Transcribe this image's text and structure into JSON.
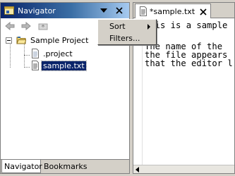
{
  "navigator": {
    "title": "Navigator",
    "tree": {
      "project": "Sample Project",
      "children": [
        ".project",
        "sample.txt"
      ]
    },
    "bottom_tabs": [
      "Navigator",
      "Bookmarks"
    ]
  },
  "view_menu": {
    "items": [
      "Sort",
      "Filters..."
    ]
  },
  "editor": {
    "tab_title": "*sample.txt",
    "lines": [
      "This is a sample",
      "",
      "The name of the",
      "the file appears",
      "that the editor l"
    ]
  },
  "colors": {
    "title_bar_start": "#0a246a",
    "title_bar_end": "#a6caf0",
    "selection": "#0a246a",
    "chrome": "#d4d0c8"
  }
}
